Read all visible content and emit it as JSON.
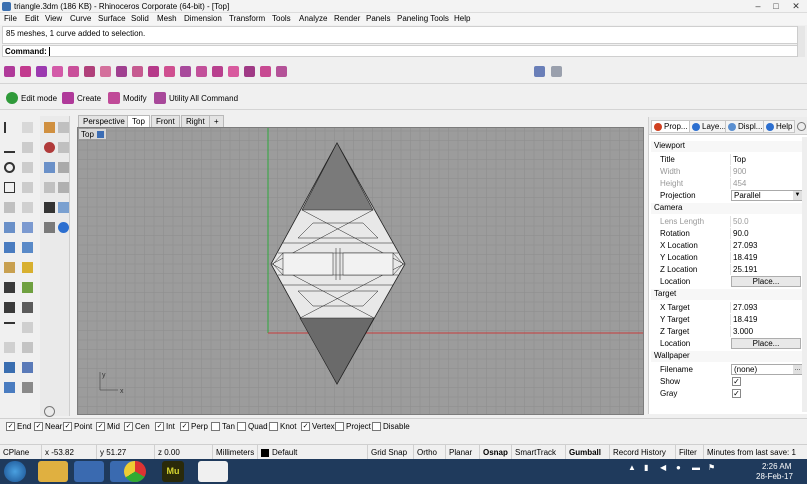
{
  "window": {
    "title": "triangle.3dm (186 KB) - Rhinoceros Corporate (64-bit) - [Top]",
    "controls": [
      "–",
      "□",
      "✕"
    ]
  },
  "menu": [
    "File",
    "Edit",
    "View",
    "Curve",
    "Surface",
    "Solid",
    "Mesh",
    "Dimension",
    "Transform",
    "Tools",
    "Analyze",
    "Render",
    "Panels",
    "Paneling Tools",
    "Help"
  ],
  "command_history": "85 meshes, 1 curve added to selection.",
  "command_prompt": "Command:",
  "command_toolbar": [
    {
      "label": "Edit mode",
      "icon": "power-icon"
    },
    {
      "label": "Create",
      "icon": "create-icon"
    },
    {
      "label": "Modify",
      "icon": "modify-icon"
    },
    {
      "label": "Utility",
      "icon": "utility-icon"
    },
    {
      "label": "All Command",
      "icon": "all-command-icon"
    }
  ],
  "viewport_tabs": [
    "Perspective",
    "Top",
    "Front",
    "Right",
    "+"
  ],
  "active_viewport": "Top",
  "viewport_label": "Top",
  "axes": {
    "x": "x",
    "y": "y"
  },
  "panel_tabs": [
    {
      "label": "Prop...",
      "icon": "properties-icon",
      "color": "#d04020"
    },
    {
      "label": "Laye...",
      "icon": "layers-icon",
      "color": "#2c6fd0"
    },
    {
      "label": "Displ...",
      "icon": "display-icon",
      "color": "#5a8fd0"
    },
    {
      "label": "Help",
      "icon": "help-icon",
      "color": "#2c6fd0"
    }
  ],
  "properties": {
    "viewport_header": "Viewport",
    "title_label": "Title",
    "title_value": "Top",
    "width_label": "Width",
    "width_value": "900",
    "height_label": "Height",
    "height_value": "454",
    "projection_label": "Projection",
    "projection_value": "Parallel",
    "camera_header": "Camera",
    "lens_label": "Lens Length",
    "lens_value": "50.0",
    "rotation_label": "Rotation",
    "rotation_value": "90.0",
    "xloc_label": "X Location",
    "xloc_value": "27.093",
    "yloc_label": "Y Location",
    "yloc_value": "18.419",
    "zloc_label": "Z Location",
    "zloc_value": "25.191",
    "location_label": "Location",
    "place_label": "Place...",
    "target_header": "Target",
    "xtarget_label": "X Target",
    "xtarget_value": "27.093",
    "ytarget_label": "Y Target",
    "ytarget_value": "18.419",
    "ztarget_label": "Z Target",
    "ztarget_value": "3.000",
    "tlocation_label": "Location",
    "tplace_label": "Place...",
    "wallpaper_header": "Wallpaper",
    "filename_label": "Filename",
    "filename_value": "(none)",
    "show_label": "Show",
    "gray_label": "Gray",
    "check_mark": "✓"
  },
  "osnaps": [
    {
      "label": "End",
      "checked": true
    },
    {
      "label": "Near",
      "checked": true
    },
    {
      "label": "Point",
      "checked": true
    },
    {
      "label": "Mid",
      "checked": true
    },
    {
      "label": "Cen",
      "checked": true
    },
    {
      "label": "Int",
      "checked": true
    },
    {
      "label": "Perp",
      "checked": true
    },
    {
      "label": "Tan",
      "checked": false
    },
    {
      "label": "Quad",
      "checked": false
    },
    {
      "label": "Knot",
      "checked": false
    },
    {
      "label": "Vertex",
      "checked": true
    },
    {
      "label": "Project",
      "checked": false
    },
    {
      "label": "Disable",
      "checked": false
    }
  ],
  "status": {
    "cplane": "CPlane",
    "x": "x -53.82",
    "y": "y 51.27",
    "z": "z 0.00",
    "units": "Millimeters",
    "layer": "Default",
    "grid_snap": "Grid Snap",
    "ortho": "Ortho",
    "planar": "Planar",
    "osnap": "Osnap",
    "smarttrack": "SmartTrack",
    "gumball": "Gumball",
    "record_history": "Record History",
    "filter": "Filter",
    "minutes": "Minutes from last save: 1"
  },
  "taskbar": {
    "time": "2:26 AM",
    "date": "28-Feb-17",
    "mu_label": "Mu"
  },
  "colors": {
    "viewport_bg": "#9c9c9c",
    "grid_line": "#8d8d8d",
    "x_axis": "#c83c3c",
    "y_axis": "#2ea83c",
    "accent": "#3c6db4"
  }
}
